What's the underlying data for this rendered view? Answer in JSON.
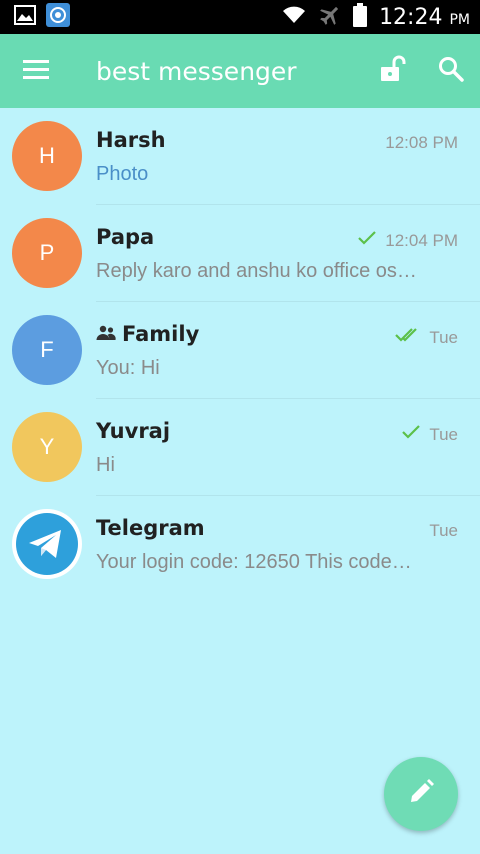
{
  "status_bar": {
    "time": "12:24",
    "ampm": "PM",
    "icons": [
      "gallery-icon",
      "app-notification-icon",
      "wifi-icon",
      "airplane-mode-icon",
      "battery-icon"
    ]
  },
  "app_bar": {
    "title": "best messenger",
    "icons": [
      "menu-icon",
      "unlock-icon",
      "search-icon"
    ],
    "color": "#69dbb3"
  },
  "chats": [
    {
      "name": "Harsh",
      "initial": "H",
      "time": "12:08 PM",
      "message": "Photo",
      "avatar_color": "#f3884a",
      "check": "none",
      "group": false,
      "media": true
    },
    {
      "name": "Papa",
      "initial": "P",
      "time": "12:04 PM",
      "message": "Reply karo and anshu ko office os…",
      "avatar_color": "#f3884a",
      "check": "single",
      "group": false,
      "media": false
    },
    {
      "name": "Family",
      "initial": "F",
      "time": "Tue",
      "message": "You: Hi",
      "avatar_color": "#5c9de0",
      "check": "double",
      "group": true,
      "media": false
    },
    {
      "name": "Yuvraj",
      "initial": "Y",
      "time": "Tue",
      "message": "Hi",
      "avatar_color": "#f1c75d",
      "check": "single",
      "group": false,
      "media": false
    },
    {
      "name": "Telegram",
      "initial": "",
      "time": "Tue",
      "message": "Your login code: 12650  This code…",
      "avatar_color": "#2ea0db",
      "check": "none",
      "group": false,
      "media": false
    }
  ],
  "fab": {
    "icon": "pencil-icon",
    "color": "#6fdcb5"
  },
  "colors": {
    "background": "#bdf3fb",
    "check": "#5cc04a",
    "media_text": "#4a8fc8"
  }
}
